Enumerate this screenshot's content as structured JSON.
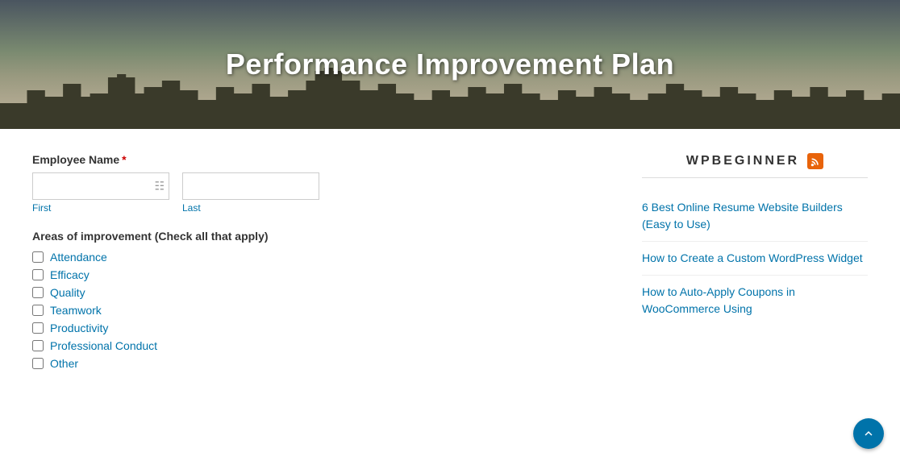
{
  "hero": {
    "title": "Performance Improvement Plan"
  },
  "form": {
    "employee_name_label": "Employee Name",
    "required_marker": "*",
    "first_label": "First",
    "last_label": "Last",
    "areas_label": "Areas of improvement (Check all that apply)",
    "checkboxes": [
      {
        "id": "attendance",
        "label": "Attendance"
      },
      {
        "id": "efficacy",
        "label": "Efficacy"
      },
      {
        "id": "quality",
        "label": "Quality"
      },
      {
        "id": "teamwork",
        "label": "Teamwork"
      },
      {
        "id": "productivity",
        "label": "Productivity"
      },
      {
        "id": "professional_conduct",
        "label": "Professional Conduct"
      },
      {
        "id": "other",
        "label": "Other"
      }
    ]
  },
  "sidebar": {
    "title": "WPBEGINNER",
    "links": [
      {
        "text": "6 Best Online Resume Website Builders (Easy to Use)"
      },
      {
        "text": "How to Create a Custom WordPress Widget"
      },
      {
        "text": "How to Auto-Apply Coupons in WooCommerce Using"
      }
    ]
  },
  "scroll_top": {
    "aria_label": "Scroll to top"
  }
}
